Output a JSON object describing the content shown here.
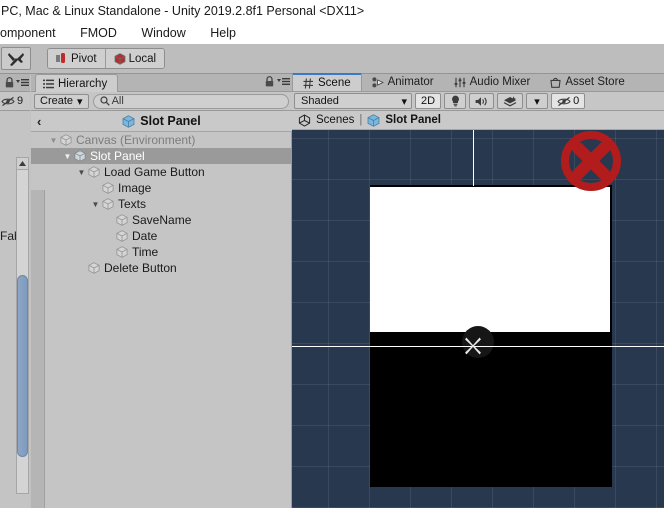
{
  "window": {
    "title": "PC, Mac & Linux Standalone - Unity 2019.2.8f1 Personal <DX11>"
  },
  "menubar": {
    "items": [
      "omponent",
      "FMOD",
      "Window",
      "Help"
    ]
  },
  "toolbar": {
    "tools_icon": "tools-icon",
    "pivot_label": "Pivot",
    "pivot_icon": "pivot-icon",
    "local_label": "Local",
    "local_icon": "cube-icon"
  },
  "left_strip": {
    "lock_icon": "lock-icon",
    "menu_icon": "hamburger-menu-icon",
    "gizmo_icon": "eye-slash-icon",
    "gizmo_count": "9",
    "clipped_label": "Fab",
    "scroll_up_icon": "triangle-up-icon"
  },
  "hierarchy": {
    "tab_label": "Hierarchy",
    "tab_icon": "hierarchy-icon",
    "lock_icon": "lock-icon",
    "menu_icon": "hamburger-menu-icon",
    "create_label": "Create",
    "create_caret": "▾",
    "search_icon": "search-icon",
    "search_placeholder": "All",
    "search_value": "",
    "prefab_back_icon": "chevron-left-icon",
    "prefab_title": "Slot Panel",
    "prefab_icon": "prefab-cube-icon",
    "tree": [
      {
        "label": "Canvas (Environment)",
        "depth": 0,
        "arrow": "▼",
        "selected": false,
        "dim": true,
        "icon": "gameobject-icon"
      },
      {
        "label": "Slot Panel",
        "depth": 1,
        "arrow": "▼",
        "selected": true,
        "dim": false,
        "icon": "prefab-cube-icon"
      },
      {
        "label": "Load Game Button",
        "depth": 2,
        "arrow": "▼",
        "selected": false,
        "dim": false,
        "icon": "gameobject-icon"
      },
      {
        "label": "Image",
        "depth": 3,
        "arrow": "",
        "selected": false,
        "dim": false,
        "icon": "gameobject-icon"
      },
      {
        "label": "Texts",
        "depth": 3,
        "arrow": "▼",
        "selected": false,
        "dim": false,
        "icon": "gameobject-icon"
      },
      {
        "label": "SaveName",
        "depth": 4,
        "arrow": "",
        "selected": false,
        "dim": false,
        "icon": "gameobject-icon"
      },
      {
        "label": "Date",
        "depth": 4,
        "arrow": "",
        "selected": false,
        "dim": false,
        "icon": "gameobject-icon"
      },
      {
        "label": "Time",
        "depth": 4,
        "arrow": "",
        "selected": false,
        "dim": false,
        "icon": "gameobject-icon"
      },
      {
        "label": "Delete Button",
        "depth": 2,
        "arrow": "",
        "selected": false,
        "dim": false,
        "icon": "gameobject-icon"
      }
    ]
  },
  "scene": {
    "tabs": [
      {
        "label": "Scene",
        "icon": "grid-hash-icon",
        "active": true
      },
      {
        "label": "Animator",
        "icon": "animator-icon",
        "active": false
      },
      {
        "label": "Audio Mixer",
        "icon": "audio-mixer-icon",
        "active": false
      },
      {
        "label": "Asset Store",
        "icon": "store-bag-icon",
        "active": false
      }
    ],
    "toolbar": {
      "draw_mode": "Shaded",
      "draw_mode_caret": "▾",
      "two_d_label": "2D",
      "two_d_active": true,
      "light_icon": "lightbulb-icon",
      "audio_icon": "speaker-icon",
      "effects_icon": "effects-icon",
      "effects_caret": "▾",
      "gizmos_icon": "eye-slash-icon",
      "gizmos_count": "0"
    },
    "breadcrumb": {
      "root_label": "Scenes",
      "root_icon": "unity-logo-icon",
      "separator": "|",
      "current_label": "Slot Panel",
      "current_icon": "prefab-cube-icon"
    },
    "viewport": {
      "background_color": "#27384f",
      "grid_color": "#3a4c64",
      "white_panel_color": "#ffffff",
      "black_panel_color": "#000000",
      "delete_icon": "red-circle-x-icon",
      "delete_icon_color": "#b31c1c",
      "gizmo_icon": "move-pivot-gizmo-icon",
      "guide_line_color": "#ffffff"
    }
  }
}
